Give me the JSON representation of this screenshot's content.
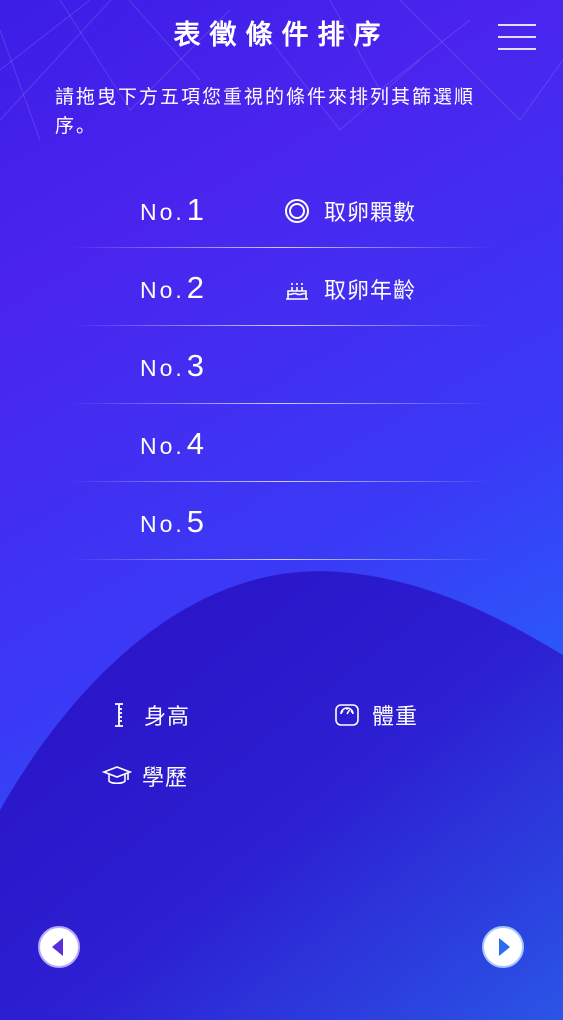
{
  "header": {
    "title": "表徵條件排序",
    "menu_icon": "hamburger-menu-icon"
  },
  "instruction": "請拖曳下方五項您重視的條件來排列其篩選順序。",
  "ranking": [
    {
      "prefix": "No.",
      "number": "1",
      "item": {
        "label": "取卵顆數",
        "icon": "egg-ring-icon"
      }
    },
    {
      "prefix": "No.",
      "number": "2",
      "item": {
        "label": "取卵年齡",
        "icon": "birthday-cake-icon"
      }
    },
    {
      "prefix": "No.",
      "number": "3",
      "item": null
    },
    {
      "prefix": "No.",
      "number": "4",
      "item": null
    },
    {
      "prefix": "No.",
      "number": "5",
      "item": null
    }
  ],
  "options": [
    {
      "label": "身高",
      "icon": "height-ruler-icon"
    },
    {
      "label": "體重",
      "icon": "weight-scale-icon"
    },
    {
      "label": "學歷",
      "icon": "graduation-cap-icon"
    }
  ],
  "navigation": {
    "prev_icon": "arrow-left-circle-icon",
    "next_icon": "arrow-right-circle-icon"
  },
  "colors": {
    "background_start": "#3c1ee6",
    "background_end": "#1f90f8",
    "wave_dark": "#2b12c8",
    "text": "#ffffff",
    "nav_arrow_prev": "#5a2ee0",
    "nav_arrow_next": "#2b6cf0"
  }
}
